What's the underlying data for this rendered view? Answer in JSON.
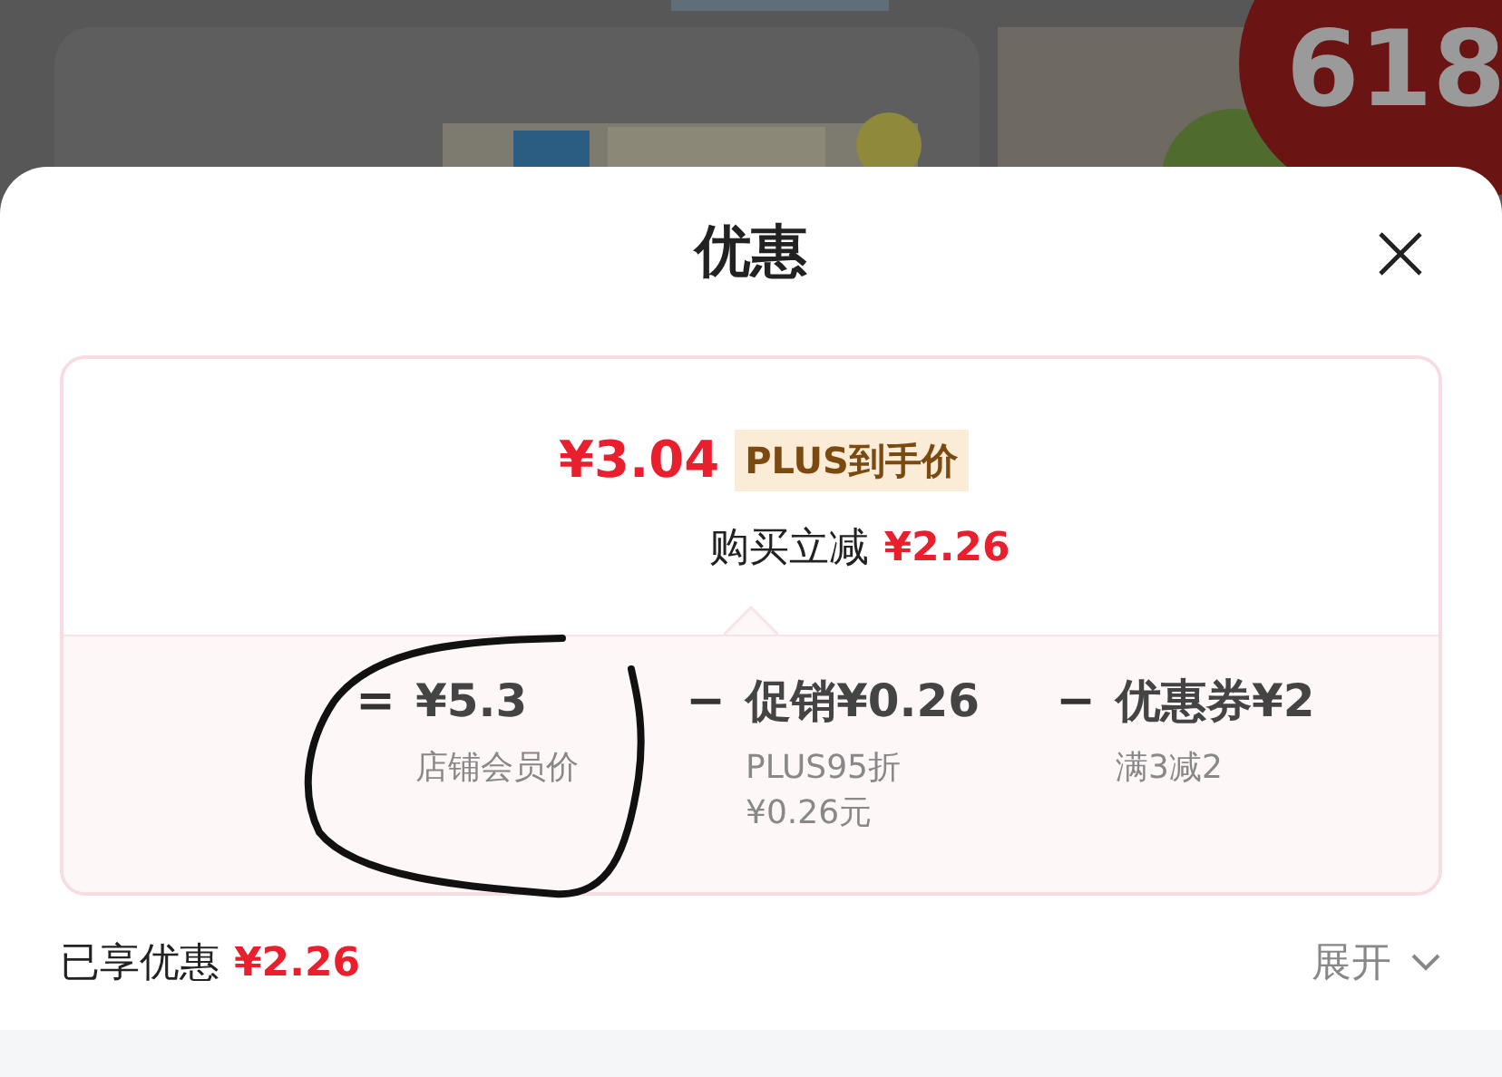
{
  "background": {
    "badge": "618"
  },
  "sheet": {
    "title": "优惠",
    "summary": {
      "price": "¥3.04",
      "price_tag": "PLUS到手价",
      "reduction_label": "购买立减",
      "reduction_amount": "¥2.26"
    },
    "breakdown": [
      {
        "kind": "equals",
        "sign": "=",
        "amount": "¥5.3",
        "notes": [
          "店铺会员价"
        ]
      },
      {
        "kind": "minus",
        "sign": "−",
        "label": "促销",
        "amount": "¥0.26",
        "notes": [
          "PLUS95折",
          "¥0.26元"
        ]
      },
      {
        "kind": "minus",
        "sign": "−",
        "label": "优惠券",
        "amount": "¥2",
        "notes": [
          "满3减2"
        ]
      }
    ],
    "footer": {
      "label": "已享优惠",
      "amount": "¥2.26",
      "toggle": "展开",
      "expanded": false
    }
  }
}
